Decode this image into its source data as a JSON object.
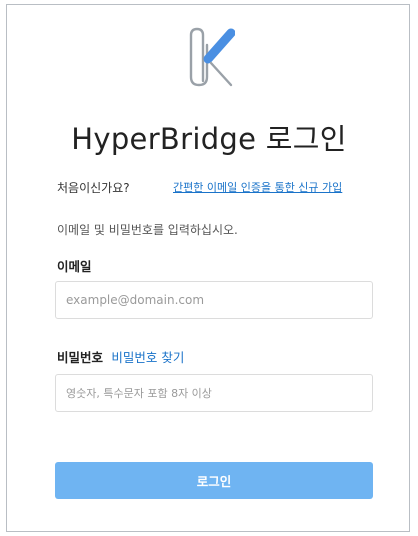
{
  "logo": {
    "icon": "paperclip-k-logo-icon",
    "colors": {
      "clip": "#9aa1a8",
      "accent": "#4a8fe2"
    }
  },
  "header": {
    "title": "HyperBridge 로그인"
  },
  "signup": {
    "question": "처음이신가요?",
    "link_label": "간편한 이메일 인증을 통한 신규 가입"
  },
  "instruction": "이메일 및 비밀번호를 입력하십시오.",
  "email": {
    "label": "이메일",
    "placeholder": "example@domain.com",
    "value": ""
  },
  "password": {
    "label": "비밀번호",
    "find_link": "비밀번호 찾기",
    "placeholder": "영숫자, 특수문자 포함 8자 이상",
    "value": ""
  },
  "login_button": {
    "label": "로그인",
    "color": "#6fb4f2"
  },
  "colors": {
    "link": "#1a73c9",
    "border": "#b9bec4"
  }
}
